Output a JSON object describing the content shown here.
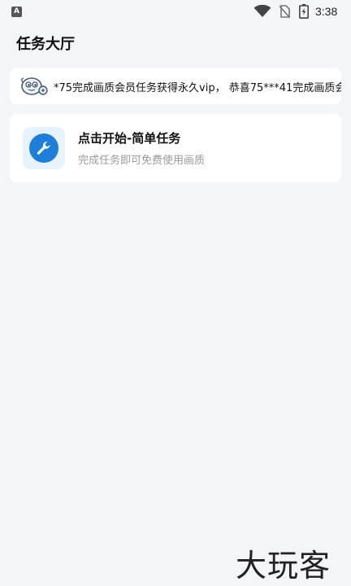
{
  "status_bar": {
    "app_badge": "A",
    "time": "3:38",
    "icons": [
      "app-notification-icon",
      "wifi-icon",
      "no-sim-icon",
      "battery-charging-icon"
    ]
  },
  "header": {
    "title": "任务大厅"
  },
  "notice": {
    "icon": "mascot-icon",
    "text": "*75完成画质会员任务获得永久vip，  恭喜75***41完成画质会"
  },
  "task": {
    "icon": "wrench-icon",
    "title": "点击开始-简单任务",
    "subtitle": "完成任务即可免费使用画质"
  },
  "watermark": {
    "text": "大玩客"
  },
  "colors": {
    "background": "#f4f5f9",
    "card": "#ffffff",
    "accent": "#1e7fdb",
    "accent_light": "#e6f2fc",
    "muted_text": "#999999"
  }
}
